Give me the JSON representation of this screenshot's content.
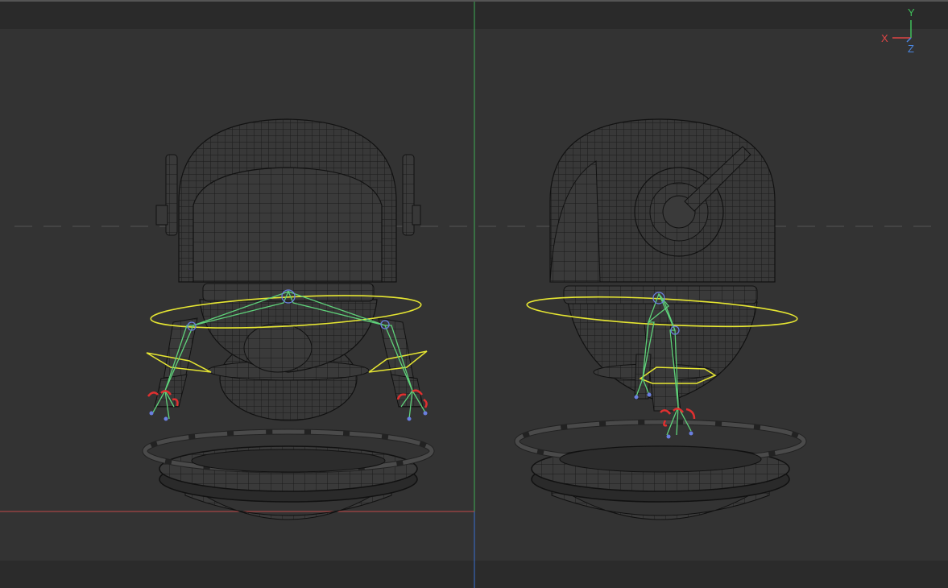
{
  "viewport": {
    "axis_gizmo": {
      "x_label": "X",
      "y_label": "Y",
      "z_label": "Z",
      "x_color": "#e04545",
      "y_color": "#3fbf5a",
      "z_color": "#4a86e0"
    }
  },
  "colors": {
    "background": "#333333",
    "wireframe": "#111111",
    "mesh_fill": "#3a3a3a",
    "bones": "#5fd27a",
    "controls": "#e6e632",
    "ik_handles": "#e03030",
    "horizon_dash": "#4a4a4a"
  },
  "views": [
    {
      "name": "front-view",
      "label": ""
    },
    {
      "name": "side-view",
      "label": ""
    }
  ]
}
